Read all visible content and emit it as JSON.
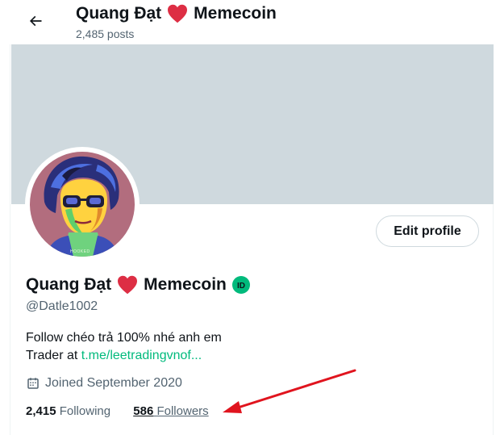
{
  "header": {
    "name": "Quang Đạt",
    "name_suffix": "Memecoin",
    "posts_count": "2,485 posts"
  },
  "profile": {
    "display_name": "Quang Đạt",
    "display_name_suffix": "Memecoin",
    "handle": "@Datle1002",
    "bio_line1": "Follow chéo trả 100% nhé anh em",
    "bio_line2_prefix": "Trader at ",
    "bio_link": "t.me/leetradingvnof...",
    "joined": "Joined September 2020",
    "avatar_caption": "HOOKED"
  },
  "actions": {
    "edit_profile_label": "Edit profile"
  },
  "stats": {
    "following_count": "2,415",
    "following_label": "Following",
    "followers_count": "586",
    "followers_label": "Followers"
  },
  "icons": {
    "back": "arrow-left-icon",
    "heart": "red-heart-emoji",
    "badge": "id-badge-icon",
    "calendar": "calendar-icon"
  },
  "colors": {
    "banner": "#cfd9de",
    "link": "#00ba7c",
    "heart": "#e0245e",
    "badge": "#00ba7c",
    "annotation_arrow": "#e0141e",
    "muted_text": "#536471"
  }
}
